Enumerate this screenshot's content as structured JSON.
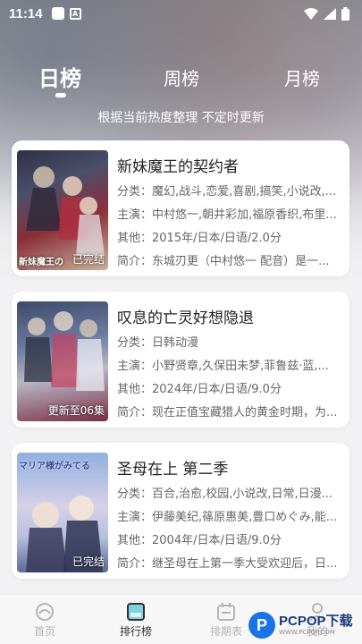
{
  "status_bar": {
    "time": "11:14",
    "a_glyph": "A"
  },
  "tabs": [
    {
      "label": "日榜",
      "active": true
    },
    {
      "label": "周榜",
      "active": false
    },
    {
      "label": "月榜",
      "active": false
    }
  ],
  "subtitle": "根据当前热度整理 不定时更新",
  "cards": [
    {
      "title": "新妹魔王的契约者",
      "genre": "分类：魔幻,战斗,恋爱,喜剧,搞笑,小说改,...",
      "cast": "主演：中村悠一,朝井彩加,福原香织,布里...",
      "other": "其他：2015年/日本/日语/2.0分",
      "intro": "简介：东城刃更（中村悠一 配音）是一...",
      "badge": "已完结",
      "poster_logo": "新妹魔王の契",
      "poster_colors": [
        "#3b3f55",
        "#8b2f3a",
        "#c9b39a"
      ]
    },
    {
      "title": "叹息的亡灵好想隐退",
      "genre": "分类：日韩动漫",
      "cast": "主演：小野贤章,久保田未梦,菲鲁兹·蓝,...",
      "other": "其他：2024年/日本/日语/9.0分",
      "intro": "简介：现在正值宝藏猎人的黄金时期，为...",
      "badge": "更新至06集",
      "poster_logo": "",
      "poster_colors": [
        "#4a5a7a",
        "#b8b8c8",
        "#8a3a4a"
      ]
    },
    {
      "title": "圣母在上 第二季",
      "genre": "分类：百合,治愈,校园,小说改,日常,日漫...",
      "cast": "主演：伊藤美纪,篠原惠美,豊口めぐみ,能...",
      "other": "其他：2004年/日本/日语/9.0分",
      "intro": "简介：继圣母在上第一季大受欢迎后，日...",
      "badge": "已完结",
      "poster_logo": "マリア様がみてる",
      "poster_colors": [
        "#6a8fc8",
        "#d8d0e8",
        "#5a6a9a"
      ]
    }
  ],
  "bottom_nav": [
    {
      "label": "首页",
      "icon": "home-icon",
      "active": false
    },
    {
      "label": "排行榜",
      "icon": "ranking-icon",
      "active": true
    },
    {
      "label": "排期表",
      "icon": "calendar-icon",
      "active": false
    },
    {
      "label": "我的",
      "icon": "profile-icon",
      "active": false
    }
  ],
  "watermark": {
    "logo": "P",
    "main": "PCPOP下载",
    "sub": "WWW.PCPOP.COM"
  },
  "colors": {
    "background": "#f2f2f4",
    "card": "#ffffff",
    "text": "#222222",
    "muted": "#666666",
    "nav_active": "#333333",
    "nav_inactive": "#b5b5b8"
  }
}
